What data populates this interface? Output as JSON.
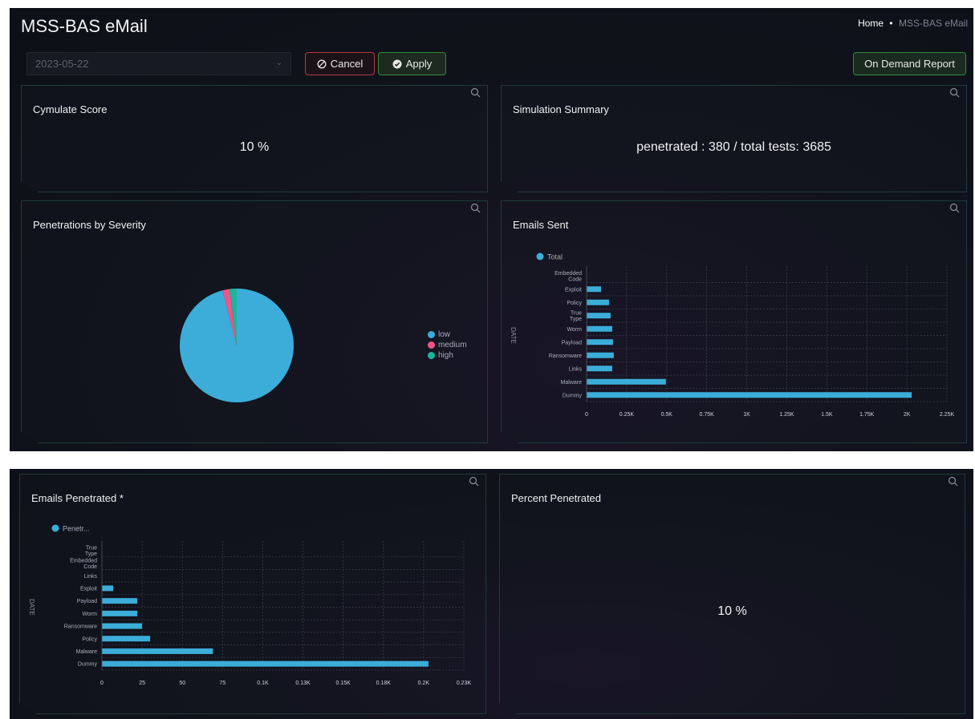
{
  "header": {
    "title": "MSS-BAS eMail",
    "breadcrumb": {
      "home": "Home",
      "separator": "•",
      "current": "MSS-BAS eMail"
    }
  },
  "toolbar": {
    "date_value": "2023-05-22",
    "cancel_label": "Cancel",
    "apply_label": "Apply",
    "report_label": "On Demand Report"
  },
  "panels": {
    "cymulate_score": {
      "title": "Cymulate Score",
      "value": "10 %"
    },
    "simulation_summary": {
      "title": "Simulation Summary",
      "value": "penetrated : 380 / total tests: 3685"
    },
    "penetrations_by_severity": {
      "title": "Penetrations by Severity"
    },
    "emails_sent": {
      "title": "Emails Sent"
    },
    "emails_penetrated": {
      "title": "Emails Penetrated *"
    },
    "percent_penetrated": {
      "title": "Percent Penetrated",
      "value": "10 %"
    }
  },
  "colors": {
    "bar": "#3badd8",
    "low": "#3badd8",
    "medium": "#f0548a",
    "high": "#19b69c",
    "cancel_border": "#b03a3a",
    "apply_border": "#2f8a3c"
  },
  "chart_data": [
    {
      "id": "severity",
      "type": "pie",
      "labels": [
        "low",
        "medium",
        "high"
      ],
      "values": [
        96,
        2,
        2
      ]
    },
    {
      "id": "emails_sent",
      "type": "bar",
      "orientation": "horizontal",
      "ylabel": "DATE",
      "legend": [
        "Total"
      ],
      "categories": [
        "Embedded Code",
        "Exploit",
        "Policy",
        "True Type",
        "Worm",
        "Payload",
        "Ransomware",
        "Links",
        "Malware",
        "Dummy"
      ],
      "series": [
        {
          "name": "Total",
          "values": [
            0,
            90,
            140,
            150,
            160,
            165,
            170,
            160,
            495,
            2030
          ]
        }
      ],
      "xlim": [
        0,
        2250
      ],
      "xticks": [
        "0",
        "0.25K",
        "0.5K",
        "0.75K",
        "1K",
        "1.25K",
        "1.5K",
        "1.75K",
        "2K",
        "2.25K"
      ],
      "grid": true
    },
    {
      "id": "emails_penetrated",
      "type": "bar",
      "orientation": "horizontal",
      "ylabel": "DATE",
      "legend": [
        "Penetr..."
      ],
      "categories": [
        "True Type",
        "Embedded Code",
        "Links",
        "Exploit",
        "Payload",
        "Worm",
        "Ransomware",
        "Policy",
        "Malware",
        "Dummy"
      ],
      "series": [
        {
          "name": "Penetr...",
          "values": [
            0,
            0,
            0,
            7,
            22,
            22,
            25,
            30,
            69,
            203
          ]
        }
      ],
      "xlim": [
        0,
        225
      ],
      "xticks": [
        "0",
        "25",
        "50",
        "75",
        "0.1K",
        "0.13K",
        "0.15K",
        "0.18K",
        "0.2K",
        "0.23K"
      ],
      "grid": true
    }
  ]
}
